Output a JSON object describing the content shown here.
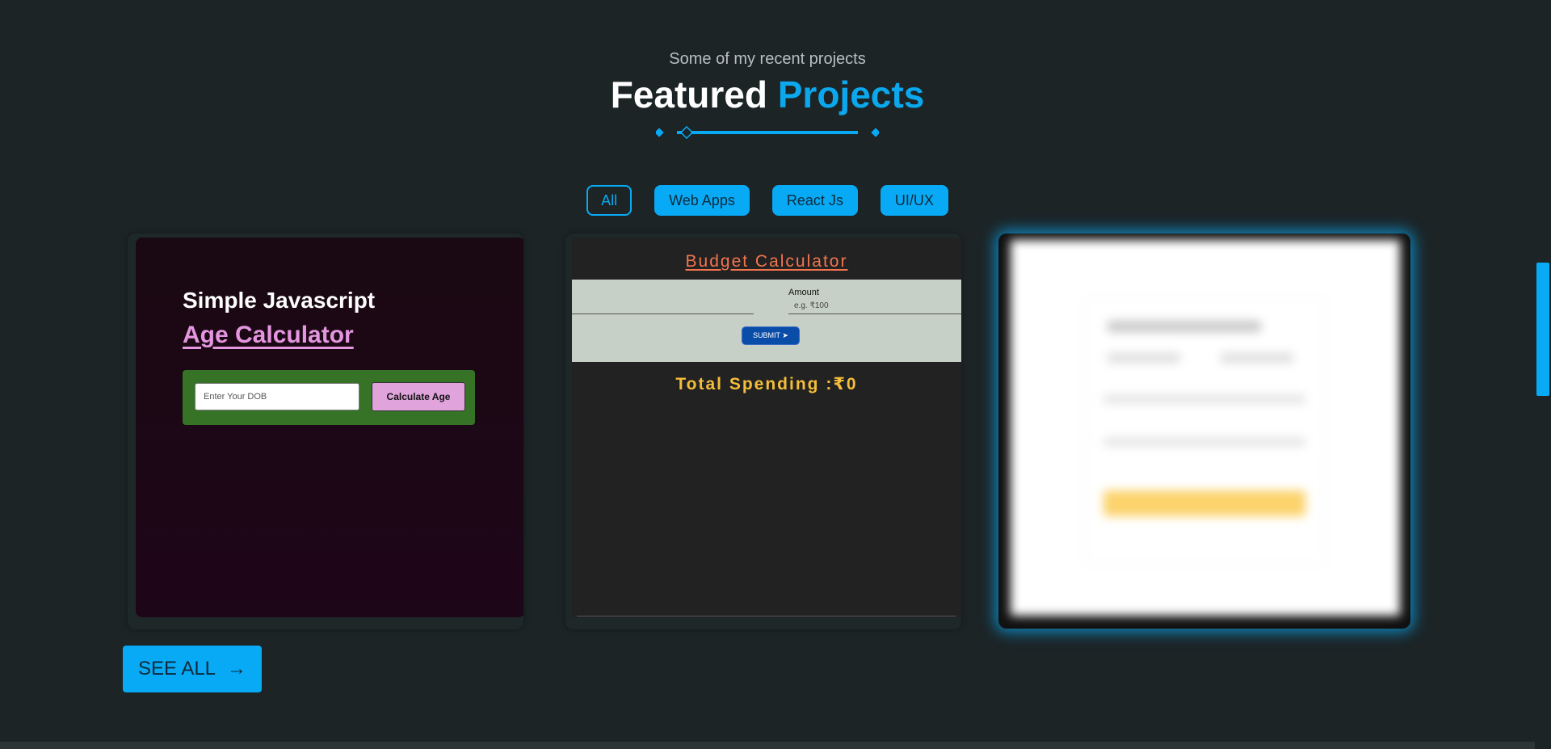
{
  "header": {
    "subtitle": "Some of my recent projects",
    "title_main": "Featured",
    "title_accent": "Projects"
  },
  "filters": [
    {
      "label": "All",
      "active": true
    },
    {
      "label": "Web Apps",
      "active": false
    },
    {
      "label": "React Js",
      "active": false
    },
    {
      "label": "UI/UX",
      "active": false
    }
  ],
  "projects": {
    "age_calc": {
      "title_line1": "Simple Javascript",
      "title_line2": "Age Calculator",
      "input_placeholder": "Enter Your DOB",
      "button_label": "Calculate Age"
    },
    "budget_calc": {
      "title": "Budget Calculator",
      "amount_label": "Amount",
      "amount_placeholder": "e.g. ₹100",
      "submit_label": "SUBMIT  ➤",
      "total_label": "Total Spending :₹0"
    }
  },
  "see_all": {
    "label": "SEE ALL",
    "arrow": "→"
  },
  "colors": {
    "accent": "#08aaf5",
    "background": "#1c2426",
    "age_form_green": "#367327",
    "age_button_pink": "#e1a3dc",
    "budget_title_orange": "#f3754e",
    "budget_total_yellow": "#f5be3a"
  }
}
